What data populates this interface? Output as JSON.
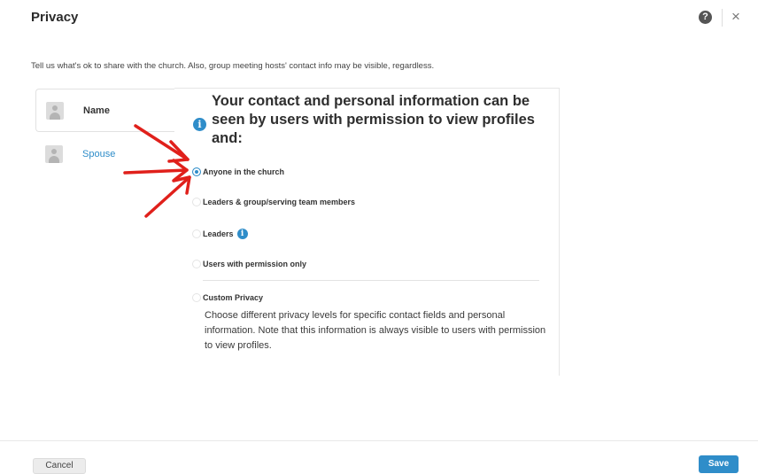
{
  "header": {
    "title": "Privacy",
    "help_icon": "help-circle-icon",
    "close_icon": "close-icon",
    "help_glyph": "?",
    "close_glyph": "×"
  },
  "intro": "Tell us what's ok to share with the church. Also, group meeting hosts' contact info may be visible, regardless.",
  "people": [
    {
      "label": "Name",
      "icon": "avatar-icon",
      "selected": true
    },
    {
      "label": "Spouse",
      "icon": "avatar-icon",
      "selected": false
    }
  ],
  "panel": {
    "heading_lines": [
      "Your contact and personal information can be",
      "seen by users with permission to view profiles",
      "and:"
    ],
    "info_glyph": "i",
    "options": [
      {
        "label": "Anyone in the church",
        "checked": true
      },
      {
        "label": "Leaders & group/serving team members",
        "checked": false
      },
      {
        "label": "Leaders",
        "checked": false,
        "has_info": true
      },
      {
        "label": "Users with permission only",
        "checked": false
      },
      {
        "label": "Custom Privacy",
        "checked": false
      }
    ],
    "custom_description": "Choose different privacy levels for specific contact fields and personal information. Note that this information is always visible to users with permission to view profiles."
  },
  "footer": {
    "cancel_label": "Cancel",
    "save_label": "Save"
  },
  "colors": {
    "accent": "#2f8dc9",
    "annotation_arrows": "#e0201b"
  }
}
